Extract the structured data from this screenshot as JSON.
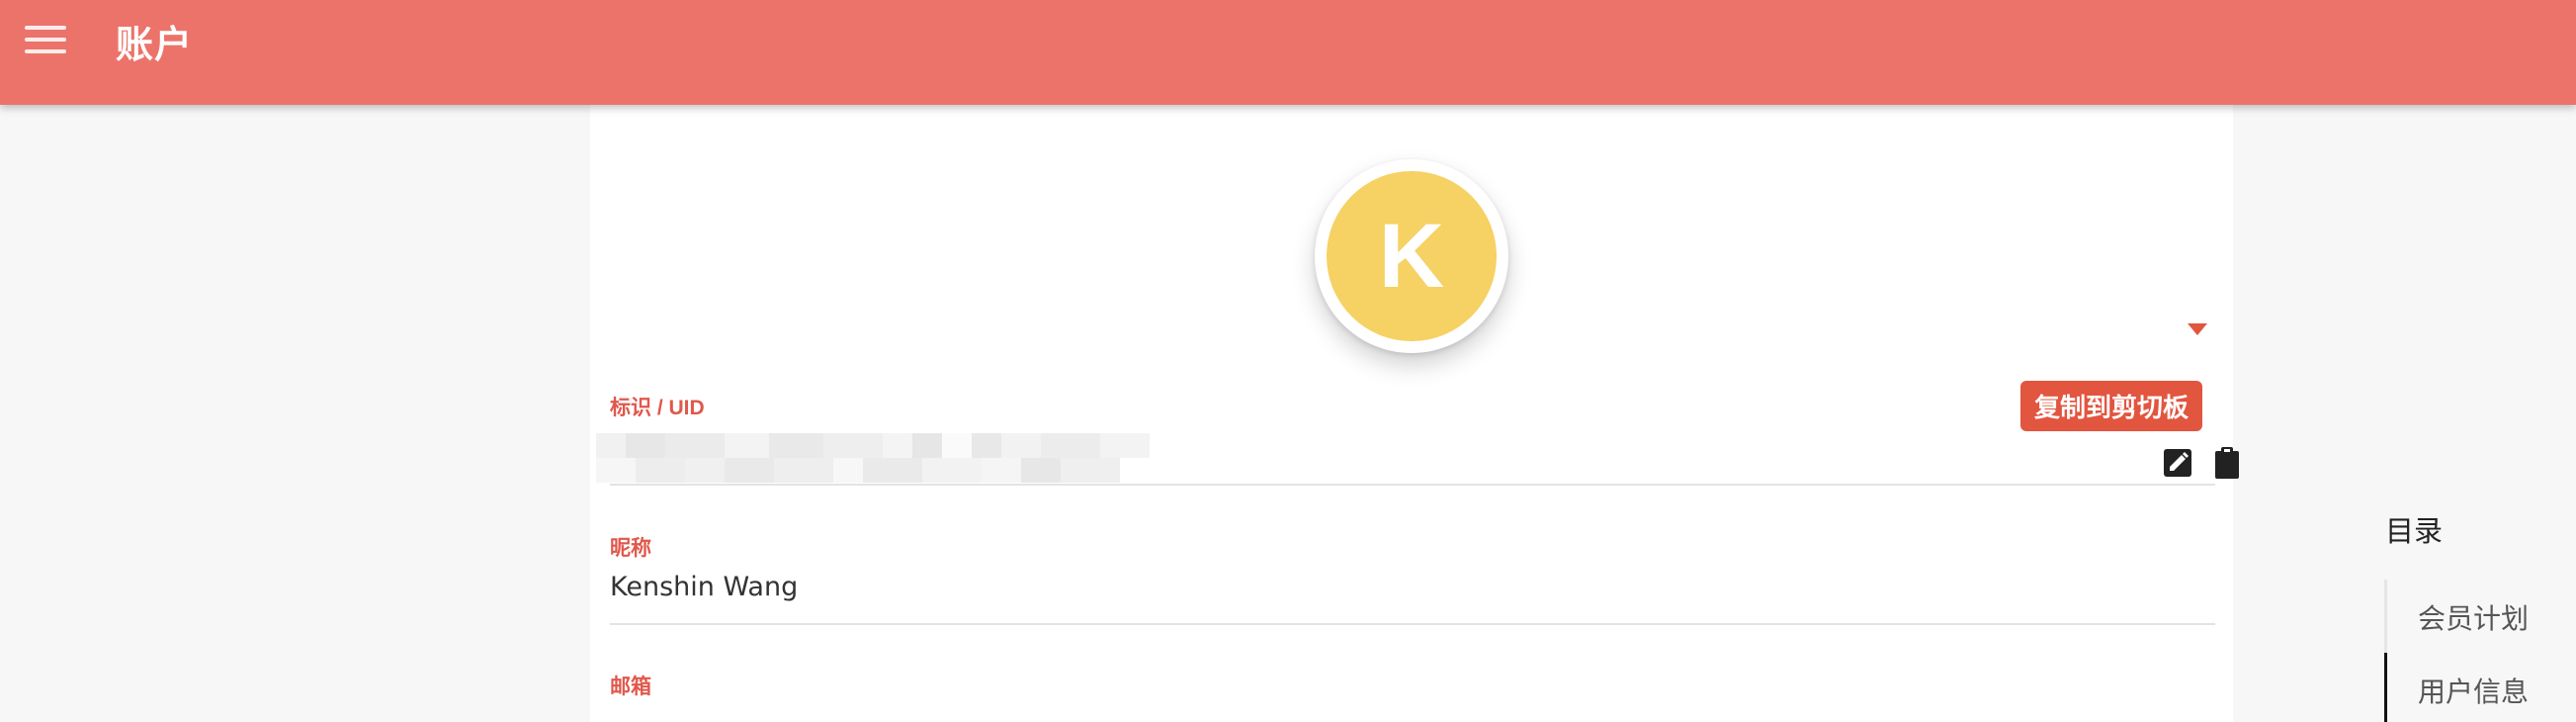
{
  "appbar": {
    "title": "账户",
    "menu_icon": "menu-icon"
  },
  "profile": {
    "avatar_letter": "K",
    "avatar_color": "#f6d163"
  },
  "fields": {
    "uid": {
      "label": "标识 / UID",
      "edit_icon": "edit-icon",
      "copy_icon": "clipboard-icon"
    },
    "nickname": {
      "label": "昵称",
      "value": "Kenshin Wang"
    },
    "email": {
      "label": "邮箱"
    }
  },
  "tooltip": {
    "text": "复制到剪切板"
  },
  "toc": {
    "title": "目录",
    "items": [
      {
        "label": "会员计划",
        "active": false
      },
      {
        "label": "用户信息",
        "active": true
      }
    ]
  },
  "colors": {
    "appbar": "#ec736a",
    "accent": "#e0584b",
    "tooltip": "#e2553f"
  }
}
